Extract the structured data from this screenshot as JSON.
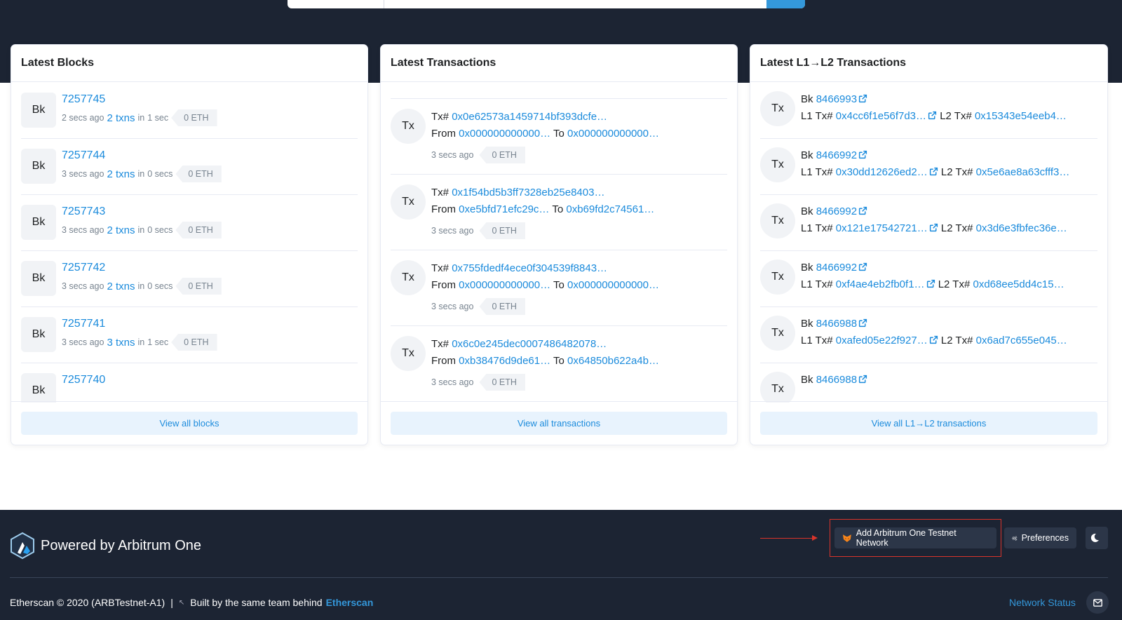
{
  "blocks_card": {
    "title": "Latest Blocks",
    "avatar_label": "Bk",
    "time_in_word": "in",
    "items": [
      {
        "number": "7257745",
        "age": "2 secs ago",
        "txns": "2 txns",
        "duration": "1 sec",
        "value": "0 ETH"
      },
      {
        "number": "7257744",
        "age": "3 secs ago",
        "txns": "2 txns",
        "duration": "0 secs",
        "value": "0 ETH"
      },
      {
        "number": "7257743",
        "age": "3 secs ago",
        "txns": "2 txns",
        "duration": "0 secs",
        "value": "0 ETH"
      },
      {
        "number": "7257742",
        "age": "3 secs ago",
        "txns": "2 txns",
        "duration": "0 secs",
        "value": "0 ETH"
      },
      {
        "number": "7257741",
        "age": "3 secs ago",
        "txns": "3 txns",
        "duration": "1 sec",
        "value": "0 ETH"
      },
      {
        "number": "7257740",
        "age": "",
        "txns": "",
        "duration": "",
        "value": ""
      }
    ],
    "view_all_label": "View all blocks"
  },
  "tx_card": {
    "title": "Latest Transactions",
    "avatar_label": "Tx",
    "tx_prefix": "Tx#",
    "from_label": "From",
    "to_label": "To",
    "items": [
      {
        "hash": "0x0e62573a1459714bf393dcfe…",
        "from": "0x000000000000…",
        "to": "0x000000000000…",
        "age": "3 secs ago",
        "value": "0 ETH"
      },
      {
        "hash": "0x1f54bd5b3ff7328eb25e8403…",
        "from": "0xe5bfd71efc29c…",
        "to": "0xb69fd2c74561…",
        "age": "3 secs ago",
        "value": "0 ETH"
      },
      {
        "hash": "0x755fdedf4ece0f304539f8843…",
        "from": "0x000000000000…",
        "to": "0x000000000000…",
        "age": "3 secs ago",
        "value": "0 ETH"
      },
      {
        "hash": "0x6c0e245dec0007486482078…",
        "from": "0xb38476d9de61…",
        "to": "0x64850b622a4b…",
        "age": "3 secs ago",
        "value": "0 ETH"
      }
    ],
    "view_all_label": "View all transactions"
  },
  "l1l2_card": {
    "title": "Latest L1→L2 Transactions",
    "avatar_label": "Tx",
    "bk_label": "Bk",
    "l1_label": "L1 Tx#",
    "l2_label": "L2 Tx#",
    "items": [
      {
        "block": "8466993",
        "l1": "0x4cc6f1e56f7d3…",
        "l2": "0x15343e54eeb4…"
      },
      {
        "block": "8466992",
        "l1": "0x30dd12626ed2…",
        "l2": "0x5e6ae8a63cfff3…"
      },
      {
        "block": "8466992",
        "l1": "0x121e17542721…",
        "l2": "0x3d6e3fbfec36e…"
      },
      {
        "block": "8466992",
        "l1": "0xf4ae4eb2fb0f1…",
        "l2": "0xd68ee5dd4c15…"
      },
      {
        "block": "8466988",
        "l1": "0xafed05e22f927…",
        "l2": "0x6ad7c655e045…"
      },
      {
        "block": "8466988",
        "l1": "",
        "l2": ""
      }
    ],
    "view_all_label": "View all L1→L2 transactions"
  },
  "footer": {
    "brand": "Powered by Arbitrum One",
    "add_network_label": "Add Arbitrum One Testnet Network",
    "preferences_label": "Preferences",
    "copyright": "Etherscan © 2020 (ARBTestnet-A1)",
    "separator": "|",
    "built_by": "Built by the same team behind",
    "etherscan_link": "Etherscan",
    "network_status": "Network Status"
  },
  "colors": {
    "link": "#1b8bdc",
    "dark_bg": "#1c2433",
    "highlight": "#d9342b"
  },
  "icons": [
    "search-icon",
    "external-link-icon",
    "fox-icon",
    "gears-icon",
    "moon-icon",
    "envelope-icon",
    "arbitrum-logo-icon"
  ]
}
